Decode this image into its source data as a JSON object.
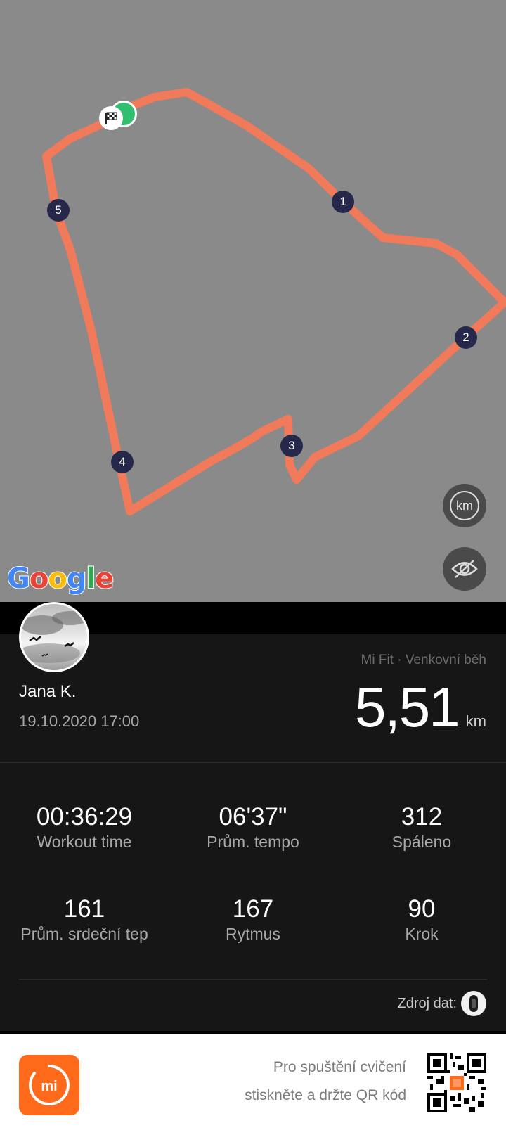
{
  "map": {
    "km_markers": [
      "1",
      "2",
      "3",
      "4",
      "5"
    ],
    "provider_logo": "Google",
    "start_finish_icon": "checkered-flag-icon",
    "route_color": "#f07a5a",
    "buttons": [
      {
        "name": "km-toggle",
        "label": "km"
      },
      {
        "name": "hide-route",
        "icon": "eye-off-icon"
      }
    ]
  },
  "workout": {
    "user_name": "Jana K.",
    "datetime": "19.10.2020 17:00",
    "source": "Mi Fit · Venkovní běh",
    "distance_value": "5,51",
    "distance_unit": "km",
    "stats": [
      {
        "value": "00:36:29",
        "label": "Workout time"
      },
      {
        "value": "06'37\"",
        "label": "Prům. tempo"
      },
      {
        "value": "312",
        "label": "Spáleno"
      },
      {
        "value": "161",
        "label": "Prům. srdeční tep"
      },
      {
        "value": "167",
        "label": "Rytmus"
      },
      {
        "value": "90",
        "label": "Krok"
      }
    ],
    "data_source_label": "Zdroj dat:"
  },
  "footer": {
    "line1": "Pro spuštění cvičení",
    "line2": "stiskněte a držte QR kód",
    "app_logo_text": "mi",
    "brand_color": "#ff6a1a"
  }
}
